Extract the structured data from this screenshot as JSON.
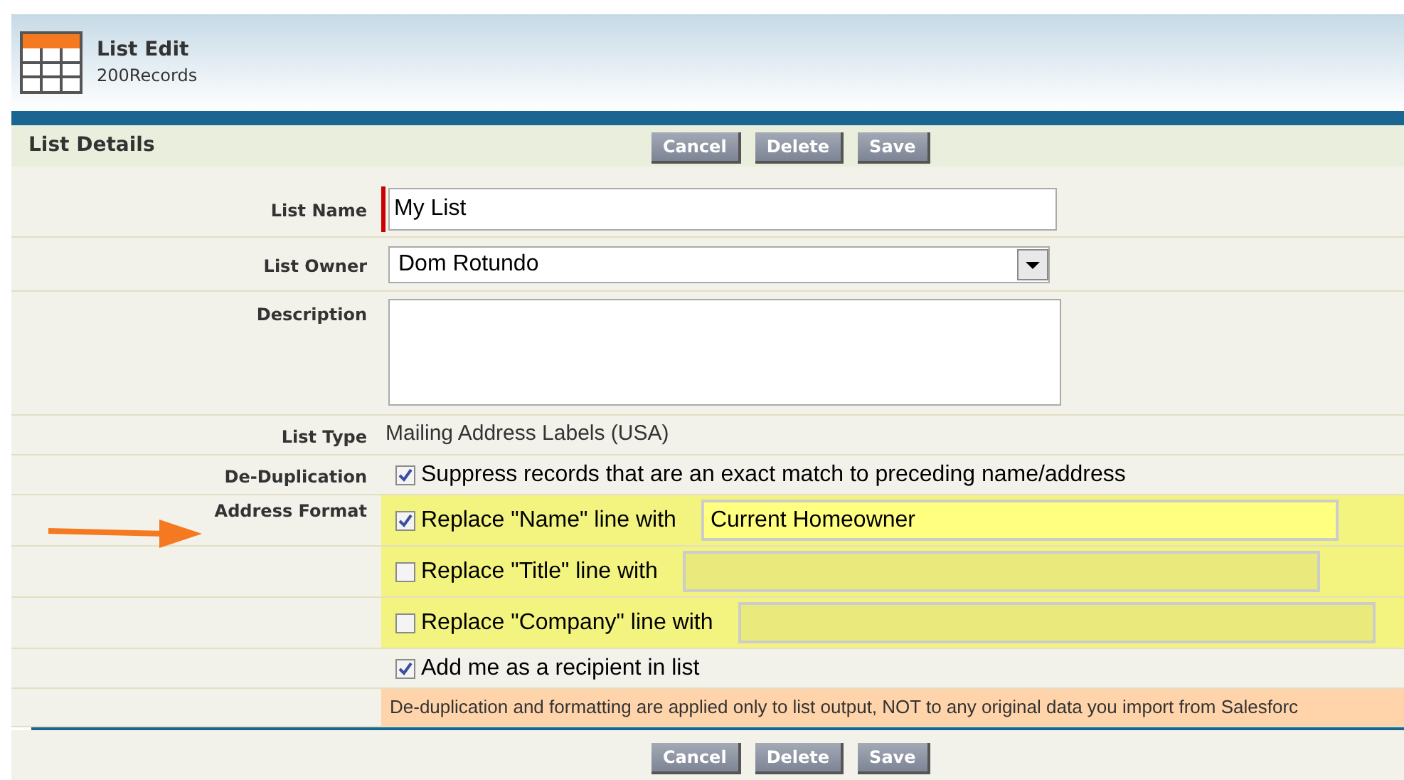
{
  "header": {
    "title": "List Edit",
    "subtitle": "200Records"
  },
  "section": {
    "title": "List Details"
  },
  "top_buttons": [
    "Cancel",
    "Delete",
    "Save"
  ],
  "fields": [
    {
      "kind": "text",
      "label": "List Name",
      "value": "My List",
      "required": true
    },
    {
      "kind": "select",
      "label": "List Owner",
      "value": "Dom Rotundo"
    },
    {
      "kind": "textarea",
      "label": "Description"
    },
    {
      "kind": "static",
      "label": "List Type",
      "value": "Mailing Address Labels (USA)"
    },
    {
      "kind": "checkbox",
      "label": "De-Duplication",
      "text": "Suppress records that are an exact match to preceding name/address",
      "checked": true
    },
    {
      "kind": "replace",
      "label": "Address Format",
      "text": "Replace \"Name\" line with",
      "checked": true,
      "value": "Current Homeowner",
      "disabled": false
    },
    {
      "kind": "replace",
      "text": "Replace \"Title\" line with",
      "checked": false,
      "disabled": true
    },
    {
      "kind": "replace",
      "text": "Replace \"Company\" line with",
      "checked": false,
      "disabled": true
    },
    {
      "kind": "checkbox",
      "text": "Add me as a recipient in list",
      "checked": true
    },
    {
      "kind": "note",
      "text": "De-duplication and formatting are applied only to list output, NOT to any original data you import from Salesforc"
    }
  ],
  "bottom_buttons": [
    "Cancel",
    "Delete",
    "Save"
  ]
}
